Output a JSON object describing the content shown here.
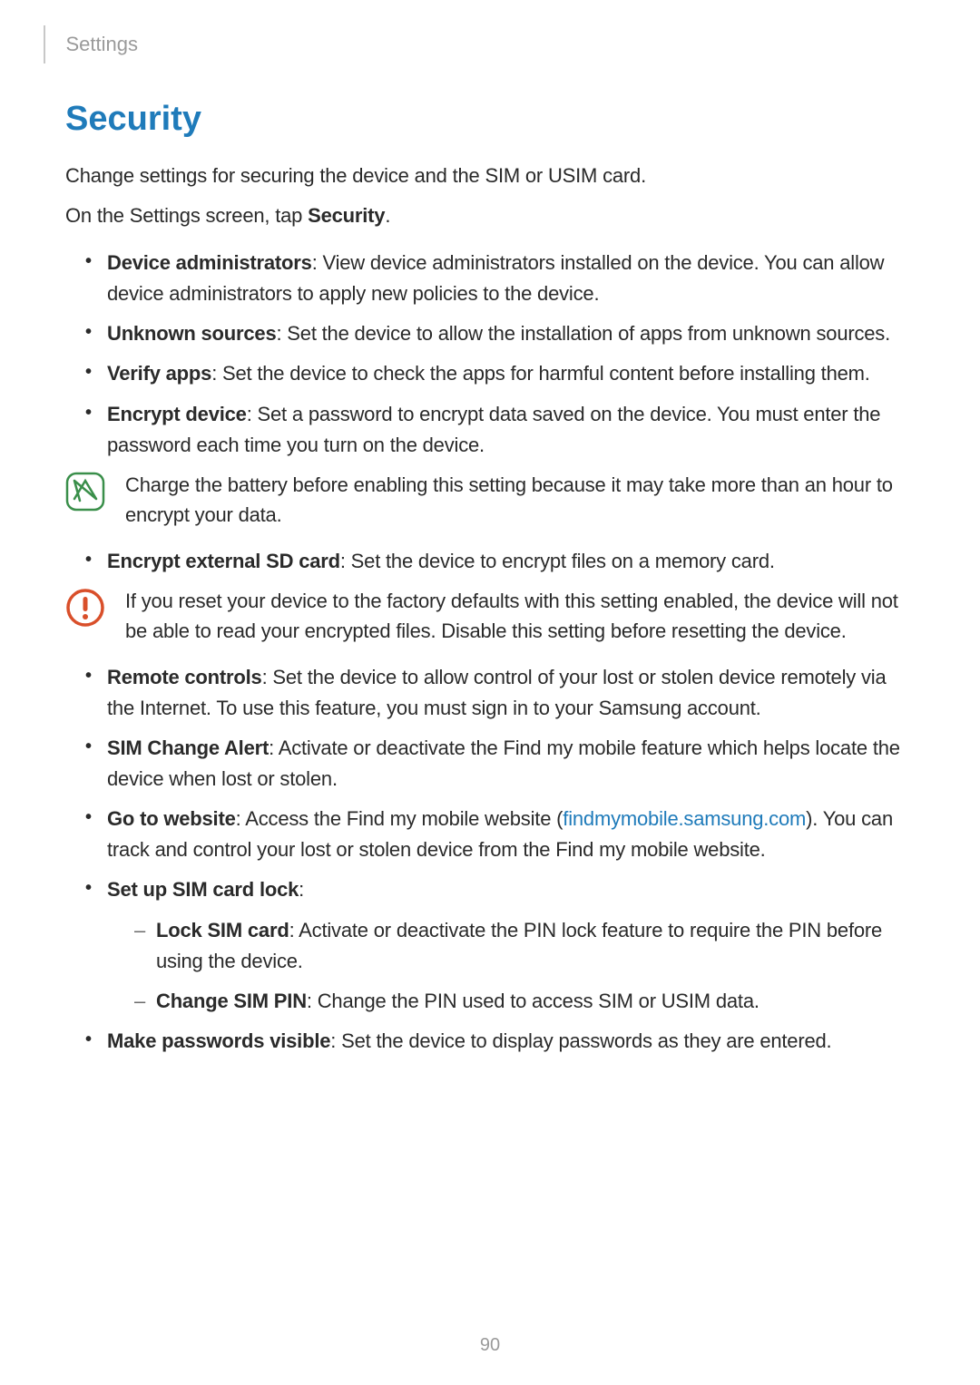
{
  "header": {
    "breadcrumb": "Settings"
  },
  "section": {
    "heading": "Security",
    "intro1": "Change settings for securing the device and the SIM or USIM card.",
    "intro2_prefix": "On the Settings screen, tap ",
    "intro2_bold": "Security",
    "intro2_suffix": "."
  },
  "items": {
    "device_admin_label": "Device administrators",
    "device_admin_text": ": View device administrators installed on the device. You can allow device administrators to apply new policies to the device.",
    "unknown_sources_label": "Unknown sources",
    "unknown_sources_text": ": Set the device to allow the installation of apps from unknown sources.",
    "verify_apps_label": "Verify apps",
    "verify_apps_text": ": Set the device to check the apps for harmful content before installing them.",
    "encrypt_device_label": "Encrypt device",
    "encrypt_device_text": ": Set a password to encrypt data saved on the device. You must enter the password each time you turn on the device.",
    "note_charge": "Charge the battery before enabling this setting because it may take more than an hour to encrypt your data.",
    "encrypt_sd_label": "Encrypt external SD card",
    "encrypt_sd_text": ": Set the device to encrypt files on a memory card.",
    "note_reset": "If you reset your device to the factory defaults with this setting enabled, the device will not be able to read your encrypted files. Disable this setting before resetting the device.",
    "remote_controls_label": "Remote controls",
    "remote_controls_text": ": Set the device to allow control of your lost or stolen device remotely via the Internet. To use this feature, you must sign in to your Samsung account.",
    "sim_change_label": "SIM Change Alert",
    "sim_change_text": ": Activate or deactivate the Find my mobile feature which helps locate the device when lost or stolen.",
    "goto_website_label": "Go to website",
    "goto_website_prefix": ": Access the Find my mobile website (",
    "goto_website_link": "findmymobile.samsung.com",
    "goto_website_suffix": "). You can track and control your lost or stolen device from the Find my mobile website.",
    "setup_sim_label": "Set up SIM card lock",
    "setup_sim_text": ":",
    "lock_sim_label": "Lock SIM card",
    "lock_sim_text": ": Activate or deactivate the PIN lock feature to require the PIN before using the device.",
    "change_pin_label": "Change SIM PIN",
    "change_pin_text": ": Change the PIN used to access SIM or USIM data.",
    "make_pw_label": "Make passwords visible",
    "make_pw_text": ": Set the device to display passwords as they are entered."
  },
  "page_number": "90"
}
